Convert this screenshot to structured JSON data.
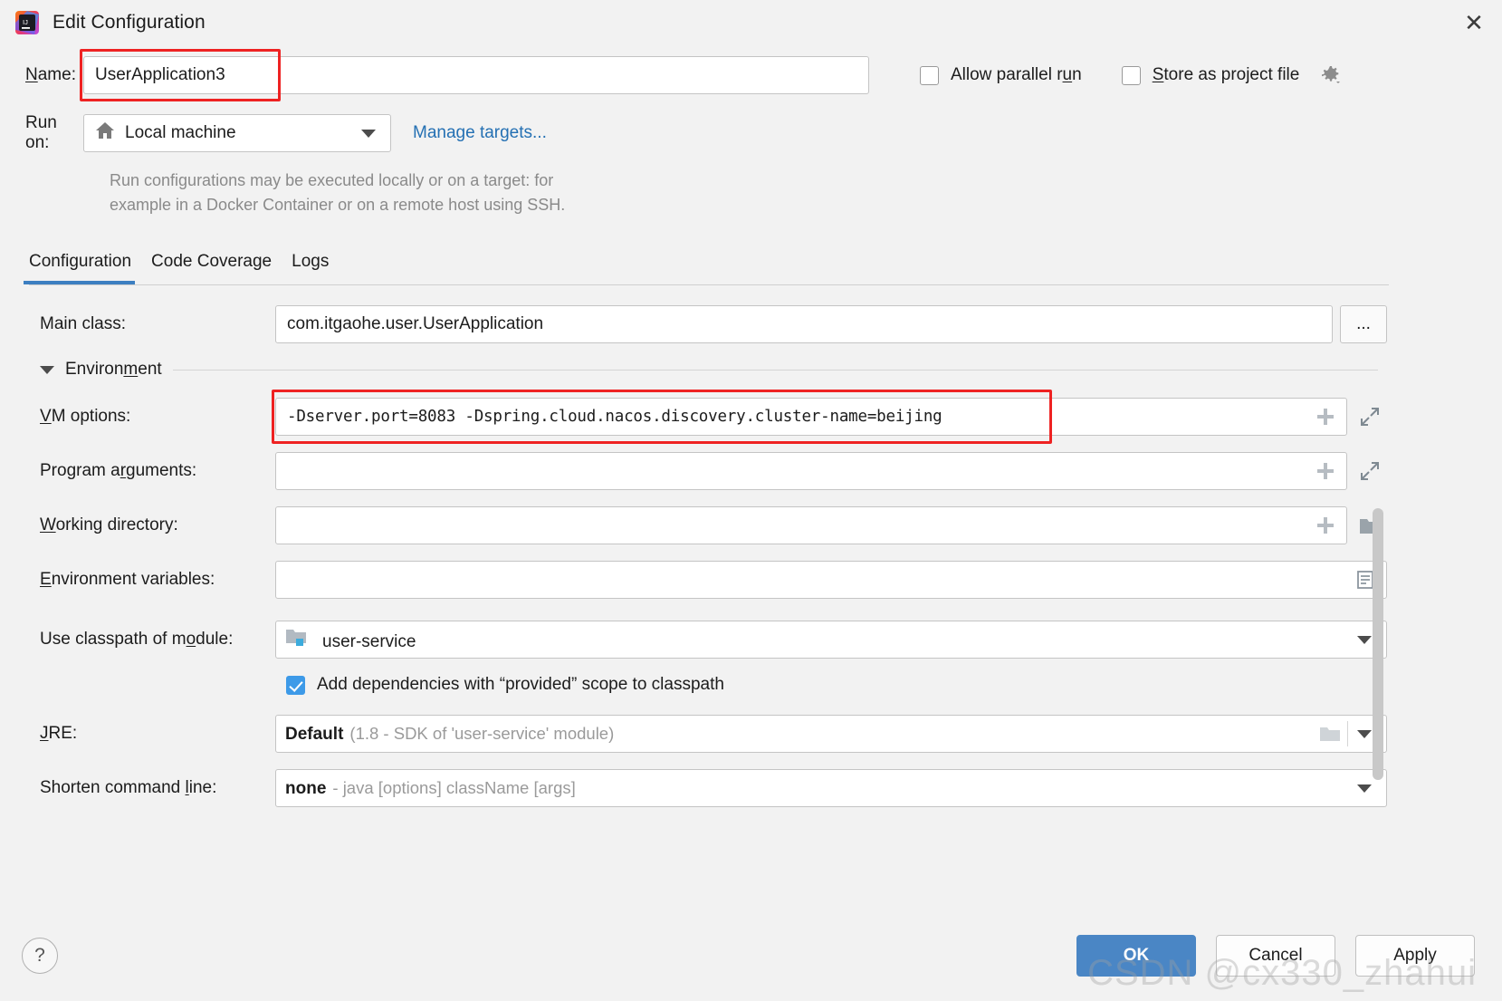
{
  "window": {
    "title": "Edit Configuration",
    "app_icon": "intellij-idea-logo",
    "close_label": "✕"
  },
  "top": {
    "name_label": "Name:",
    "name_value": "UserApplication3",
    "name_highlight_color": "#ee2222",
    "run_on_label": "Run on:",
    "run_on_value": "Local machine",
    "run_on_icon": "home-icon",
    "manage_targets_link": "Manage targets...",
    "manage_targets_color": "#2470b3",
    "hint_line1": "Run configurations may be executed locally or on a target: for",
    "hint_line2": "example in a Docker Container or on a remote host using SSH.",
    "allow_parallel_run": {
      "label_pre": "Allow parallel r",
      "label_mnemonic": "u",
      "label_post": "n",
      "checked": false
    },
    "store_as_project_file": {
      "label_mnemonic": "S",
      "label_post": "tore as project file",
      "checked": false,
      "gear_icon": "gear-dropdown-icon"
    }
  },
  "tabs": [
    {
      "label": "Configuration",
      "active": true
    },
    {
      "label": "Code Coverage",
      "active": false
    },
    {
      "label": "Logs",
      "active": false
    }
  ],
  "tab_accent_color": "#3d7fc1",
  "form": {
    "main_class": {
      "label": "Main class:",
      "value": "com.itgaohe.user.UserApplication",
      "browse_label": "...",
      "browse_icon": "ellipsis-button"
    },
    "environment_section": {
      "title_mnemonic_pre": "Environ",
      "title_mnemonic": "m",
      "title_post": "ent",
      "expanded": true,
      "collapse_icon": "triangle-down-icon"
    },
    "vm_options": {
      "label_mnemonic": "V",
      "label_post": "M options:",
      "value": "-Dserver.port=8083  -Dspring.cloud.nacos.discovery.cluster-name=beijing",
      "highlighted": true,
      "highlight_color": "#ee2222",
      "macro_icon": "plus-icon",
      "expand_icon": "expand-editor-icon"
    },
    "program_arguments": {
      "label_pre": "Program a",
      "label_mnemonic": "r",
      "label_post": "guments:",
      "value": "",
      "macro_icon": "plus-icon",
      "expand_icon": "expand-editor-icon"
    },
    "working_directory": {
      "label_mnemonic": "W",
      "label_post": "orking directory:",
      "value": "",
      "macro_icon": "plus-icon",
      "browse_icon": "folder-icon"
    },
    "environment_variables": {
      "label_mnemonic": "E",
      "label_post": "nvironment variables:",
      "value": "",
      "browse_icon": "list-editor-icon"
    },
    "classpath_module": {
      "label_pre": "Use classpath of m",
      "label_mnemonic": "o",
      "label_post": "dule:",
      "value": "user-service",
      "module_icon": "module-folder-icon",
      "dropdown_icon": "chevron-down-icon"
    },
    "add_provided_dependencies": {
      "label": "Add dependencies with “provided” scope to classpath",
      "checked": true,
      "check_color": "#3d9ae8"
    },
    "jre": {
      "label_mnemonic": "J",
      "label_post": "RE:",
      "value_bold": "Default",
      "value_gray": "(1.8 - SDK of 'user-service' module)",
      "browse_icon": "folder-icon",
      "dropdown_icon": "chevron-down-icon"
    },
    "shorten_command_line": {
      "label_pre": "Shorten command ",
      "label_mnemonic": "l",
      "label_post": "ine:",
      "value_bold": "none",
      "value_gray": "- java [options] className [args]",
      "dropdown_icon": "chevron-down-icon"
    }
  },
  "footer": {
    "help_label": "?",
    "ok_label": "OK",
    "cancel_label": "Cancel",
    "apply_label": "Apply",
    "ok_color": "#4a86c5"
  },
  "watermark": "CSDN @cx330_zhahui"
}
